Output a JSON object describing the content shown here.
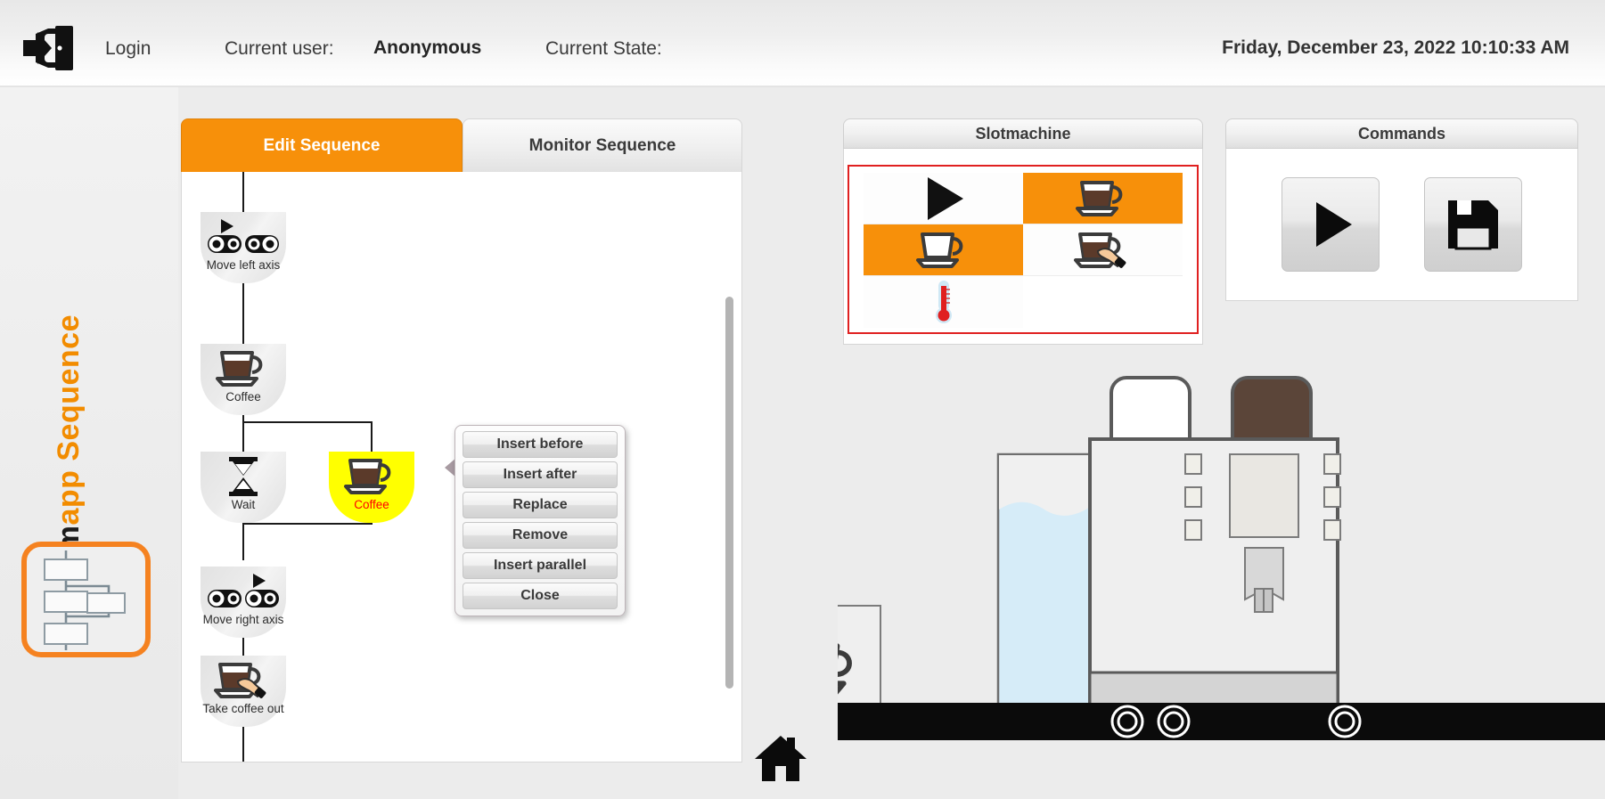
{
  "header": {
    "login_label": "Login",
    "current_user_label": "Current user:",
    "current_user_value": "Anonymous",
    "current_state_label": "Current State:",
    "current_state_value": "",
    "datetime": "Friday, December 23, 2022 10:10:33 AM",
    "login_icon": "login-door-icon"
  },
  "brand": {
    "prefix": "m",
    "suffix": "app Sequence",
    "accent_color": "#f58220",
    "icon": "sequence-flow-icon"
  },
  "tabs": [
    {
      "label": "Edit Sequence",
      "active": true
    },
    {
      "label": "Monitor Sequence",
      "active": false
    }
  ],
  "sequence": {
    "nodes": [
      {
        "label": "Move left axis",
        "icon": "axis-left-icon",
        "selected": false
      },
      {
        "label": "Coffee",
        "icon": "coffee-cup-icon",
        "selected": false
      },
      {
        "label": "Wait",
        "icon": "hourglass-icon",
        "selected": false
      },
      {
        "label": "Coffee",
        "icon": "coffee-cup-icon",
        "selected": true
      },
      {
        "label": "Move right axis",
        "icon": "axis-right-icon",
        "selected": false
      },
      {
        "label": "Take coffee out",
        "icon": "take-coffee-icon",
        "selected": false
      }
    ]
  },
  "context_menu": {
    "items": [
      "Insert before",
      "Insert after",
      "Replace",
      "Remove",
      "Insert parallel",
      "Close"
    ]
  },
  "slotmachine": {
    "title": "Slotmachine",
    "border_color": "#e02020",
    "highlight_color": "#f7900a",
    "cells": [
      {
        "icon": "play-icon",
        "highlighted": false
      },
      {
        "icon": "coffee-cup-icon",
        "highlighted": true
      },
      {
        "icon": "empty-cup-icon",
        "highlighted": true
      },
      {
        "icon": "take-coffee-icon",
        "highlighted": false
      },
      {
        "icon": "thermometer-icon",
        "highlighted": false
      },
      {
        "icon": "none",
        "highlighted": false
      }
    ]
  },
  "commands": {
    "title": "Commands",
    "buttons": [
      {
        "icon": "play-icon",
        "name": "run-button"
      },
      {
        "icon": "save-floppy-icon",
        "name": "save-button"
      }
    ]
  },
  "scene": {
    "home_icon": "home-icon",
    "water_tank_color": "#d6ecf8",
    "bean_hopper_color": "#5b4539",
    "machine_body_color": "#efefef"
  }
}
